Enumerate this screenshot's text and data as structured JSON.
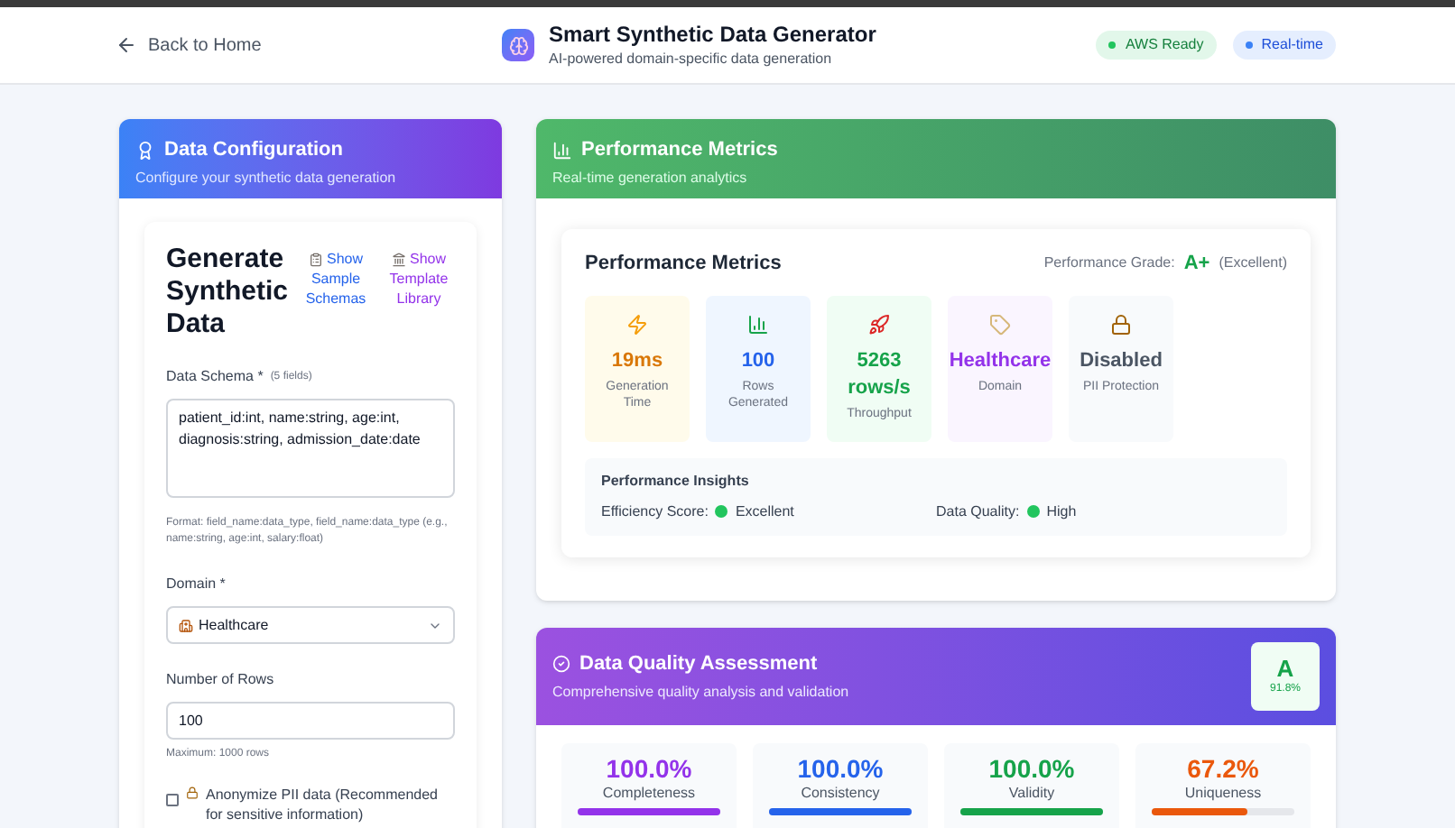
{
  "header": {
    "back_link": "Back to Home",
    "title": "Smart Synthetic Data Generator",
    "subtitle": "AI-powered domain-specific data generation",
    "badges": [
      {
        "label": "AWS Ready",
        "color": "#22c55e"
      },
      {
        "label": "Real-time",
        "color": "#3b82f6"
      }
    ]
  },
  "config_panel": {
    "title": "Data Configuration",
    "subtitle": "Configure your synthetic data generation",
    "heading": "Generate Synthetic Data",
    "links": [
      {
        "kind": "samples",
        "label": "Show Sample Schemas"
      },
      {
        "kind": "templates",
        "label": "Show Template Library"
      }
    ],
    "schema": {
      "label": "Data Schema *",
      "count": "(5 fields)",
      "value": "patient_id:int, name:string, age:int, diagnosis:string, admission_date:date",
      "hint": "Format: field_name:data_type, field_name:data_type (e.g., name:string, age:int, salary:float)"
    },
    "domain": {
      "label": "Domain *",
      "value": "Healthcare"
    },
    "rows": {
      "label": "Number of Rows",
      "value": "100",
      "hint": "Maximum: 1000 rows"
    },
    "anonymize": {
      "label": "Anonymize PII data (Recommended for sensitive information)",
      "checked": false
    }
  },
  "metrics_panel": {
    "title": "Performance Metrics",
    "subtitle": "Real-time generation analytics",
    "card_title": "Performance Metrics",
    "grade_label": "Performance Grade:",
    "grade": "A+",
    "grade_note": "(Excellent)",
    "metrics": [
      {
        "kind": "time",
        "value": "19ms",
        "label": "Generation Time"
      },
      {
        "kind": "rows",
        "value": "100",
        "label": "Rows Generated"
      },
      {
        "kind": "throughput",
        "value": "5263 rows/s",
        "label": "Throughput"
      },
      {
        "kind": "domain",
        "value": "Healthcare",
        "label": "Domain"
      },
      {
        "kind": "pii",
        "value": "Disabled",
        "label": "PII Protection"
      }
    ],
    "insights": {
      "title": "Performance Insights",
      "items": [
        {
          "label": "Efficiency Score:",
          "value": "Excellent",
          "color": "#22c55e"
        },
        {
          "label": "Data Quality:",
          "value": "High",
          "color": "#22c55e"
        }
      ]
    }
  },
  "quality_panel": {
    "title": "Data Quality Assessment",
    "subtitle": "Comprehensive quality analysis and validation",
    "grade": "A",
    "score": "91.8%",
    "scores": [
      {
        "kind": "completeness",
        "value": "100.0%",
        "label": "Completeness",
        "level": 1
      },
      {
        "kind": "consistency",
        "value": "100.0%",
        "label": "Consistency",
        "level": 1
      },
      {
        "kind": "validity",
        "value": "100.0%",
        "label": "Validity",
        "level": 1
      },
      {
        "kind": "uniqueness",
        "value": "67.2%",
        "label": "Uniqueness",
        "level": 0.672
      }
    ]
  }
}
